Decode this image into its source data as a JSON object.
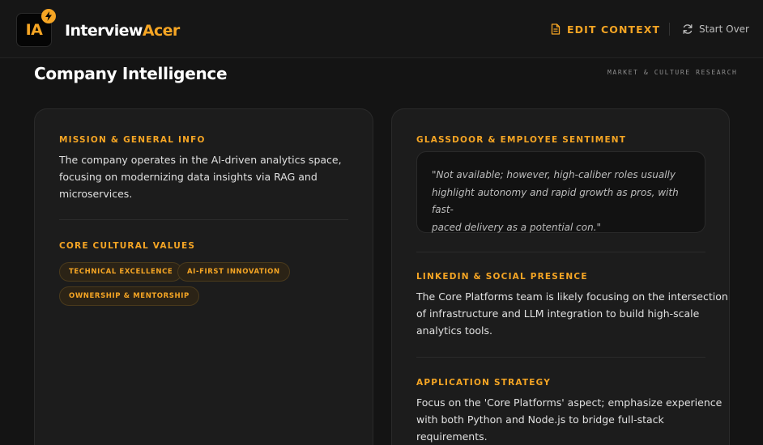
{
  "header": {
    "logo_initials": "IA",
    "brand_part1": "Interview",
    "brand_part2": "Acer",
    "edit_context_label": "EDIT CONTEXT",
    "start_over_label": "Start Over"
  },
  "section": {
    "title": "Company Intelligence",
    "subtitle": "MARKET & CULTURE RESEARCH"
  },
  "left_card": {
    "mission_label": "MISSION & GENERAL INFO",
    "mission_line1": "The company operates in the AI-driven analytics space,",
    "mission_line2": "focusing on modernizing data insights via RAG and",
    "mission_line3": "microservices.",
    "values_label": "CORE CULTURAL VALUES",
    "values": [
      "TECHNICAL EXCELLENCE",
      "AI-FIRST INNOVATION",
      "OWNERSHIP & MENTORSHIP"
    ]
  },
  "right_card": {
    "glassdoor_label": "GLASSDOOR & EMPLOYEE SENTIMENT",
    "glassdoor_line1": "\"Not available; however, high-caliber roles usually",
    "glassdoor_line2": "highlight autonomy and rapid growth as pros, with fast-",
    "glassdoor_line3": "paced delivery as a potential con.\"",
    "linkedin_label": "LINKEDIN & SOCIAL PRESENCE",
    "linkedin_line1": "The Core Platforms team is likely focusing on the intersection",
    "linkedin_line2": "of infrastructure and LLM integration to build high-scale",
    "linkedin_line3": "analytics tools.",
    "strategy_label": "APPLICATION STRATEGY",
    "strategy_line1": "Focus on the 'Core Platforms' aspect; emphasize experience",
    "strategy_line2": "with both Python and Node.js to bridge full-stack",
    "strategy_line3": "requirements."
  },
  "colors": {
    "accent": "#f5a524",
    "background": "#141414",
    "card": "#1c1c1c"
  },
  "icons": {
    "logo": "lightning-bolt-icon",
    "edit": "document-icon",
    "restart": "refresh-icon"
  }
}
